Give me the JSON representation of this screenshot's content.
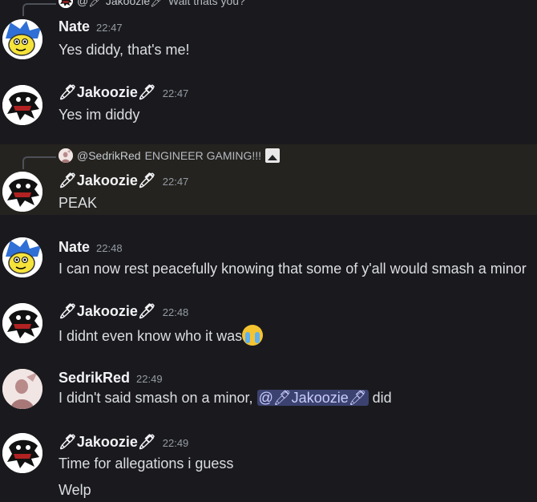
{
  "top_reply": {
    "author": "@🖊 Jakoozie🖊",
    "text": "Wait thats you?"
  },
  "messages": [
    {
      "author": "Nate",
      "time": "22:47",
      "lines": [
        "Yes diddy, that's me!"
      ]
    },
    {
      "author": "🖊Jakoozie🖊",
      "time": "22:47",
      "lines": [
        "Yes im diddy"
      ]
    },
    {
      "reply_author": "@SedrikRed",
      "reply_text": "ENGINEER GAMING!!!",
      "author": "🖊Jakoozie🖊",
      "time": "22:47",
      "lines": [
        "PEAK"
      ]
    },
    {
      "author": "Nate",
      "time": "22:48",
      "lines": [
        "I can now rest peacefully knowing that some of y'all would smash a minor"
      ]
    },
    {
      "author": "🖊Jakoozie🖊",
      "time": "22:48",
      "lines": [
        "I didnt even know who it was"
      ]
    },
    {
      "author": "SedrikRed",
      "time": "22:49",
      "text_before": "I didn't said smash on a minor, ",
      "mention": "@🖊Jakoozie🖊",
      "text_after": " did"
    },
    {
      "author": "🖊Jakoozie🖊",
      "time": "22:49",
      "lines": [
        "Time for allegations i guess",
        "Welp"
      ]
    }
  ],
  "colors": {
    "background": "#1a1a1e",
    "highlight": "#25231f",
    "mention_bg": "#3c4270",
    "mention_text": "#c9cdfb"
  },
  "icons": {
    "jakoozie_avatar": "ghost-drawing-avatar",
    "nate_avatar": "yellow-cartoon-avatar",
    "sedrik_avatar": "pink-silhouette-avatar",
    "attachment": "image-icon",
    "emoji": "crying-face-emoji"
  }
}
